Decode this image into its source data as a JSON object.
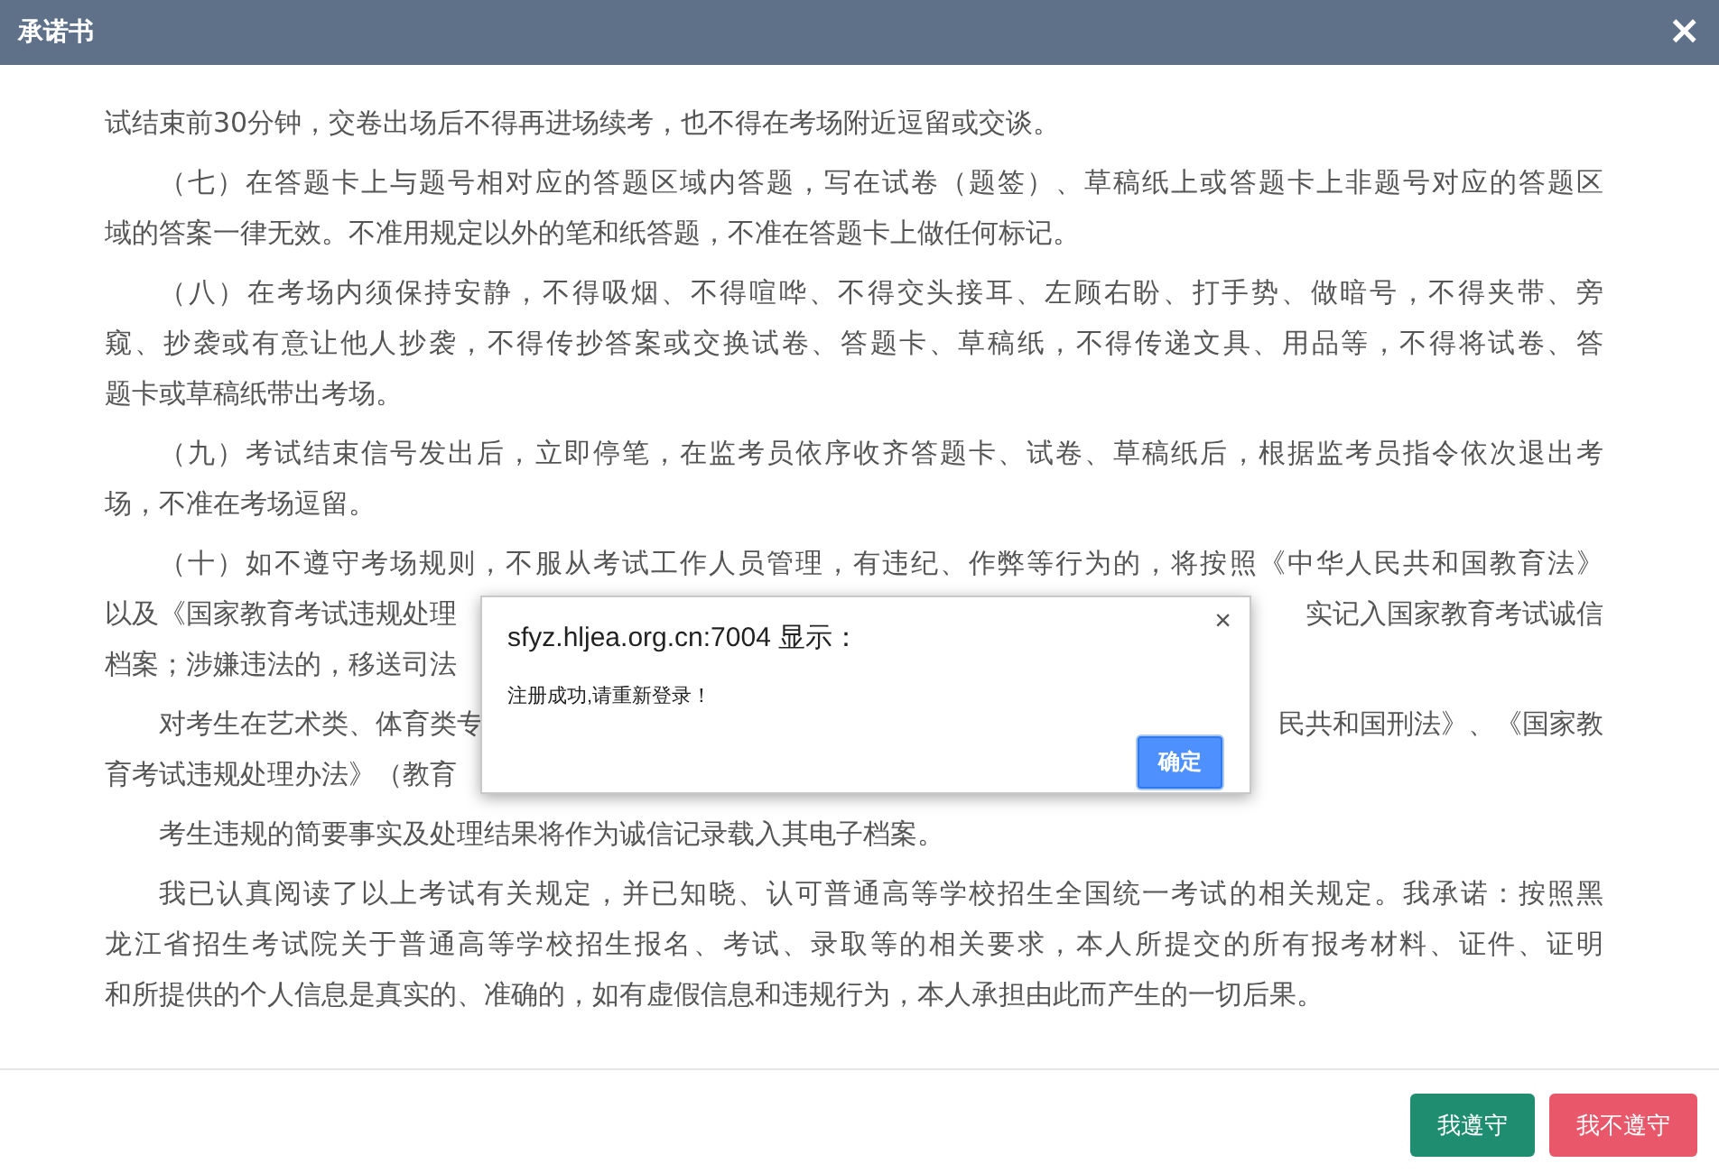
{
  "window": {
    "title": "承诺书",
    "close": "×"
  },
  "paragraphs": [
    {
      "indent": false,
      "lines": [
        "试结束前30分钟，交卷出场后不得再进场续考，也不得在考场附近逗留或交谈。"
      ]
    },
    {
      "indent": true,
      "lines": [
        "（七）在答题卡上与题号相对应的答题区域内答题，写在试卷（题签）、草稿纸上或答题卡上非题号对应的答题区",
        "域的答案一律无效。不准用规定以外的笔和纸答题，不准在答题卡上做任何标记。"
      ]
    },
    {
      "indent": true,
      "lines": [
        "（八）在考场内须保持安静，不得吸烟、不得喧哗、不得交头接耳、左顾右盼、打手势、做暗号，不得夹带、旁",
        "窥、抄袭或有意让他人抄袭，不得传抄答案或交换试卷、答题卡、草稿纸，不得传递文具、用品等，不得将试卷、答",
        "题卡或草稿纸带出考场。"
      ]
    },
    {
      "indent": true,
      "lines": [
        "（九）考试结束信号发出后，立即停笔，在监考员依序收齐答题卡、试卷、草稿纸后，根据监考员指令依次退出考",
        "场，不准在考场逗留。"
      ]
    },
    {
      "indent": true,
      "lines": [
        "（十）如不遵守考场规则，不服从考试工作人员管理，有违纪、作弊等行为的，将按照《中华人民共和国教育法》",
        {
          "left": "以及《国家教育考试违规处理",
          "right": "实记入国家教育考试诚信"
        },
        {
          "left": "档案；涉嫌违法的，移送司法"
        }
      ]
    },
    {
      "indent": true,
      "lines": [
        {
          "left": "对考生在艺术类、体育类专",
          "right": "民共和国刑法》、《国家教"
        },
        {
          "left": "育考试违规处理办法》（教育"
        }
      ]
    },
    {
      "indent": true,
      "lines": [
        "考生违规的简要事实及处理结果将作为诚信记录载入其电子档案。"
      ]
    },
    {
      "indent": true,
      "lines": [
        "我已认真阅读了以上考试有关规定，并已知晓、认可普通高等学校招生全国统一考试的相关规定。我承诺：按照黑",
        "龙江省招生考试院关于普通高等学校招生报名、考试、录取等的相关要求，本人所提交的所有报考材料、证件、证明",
        "和所提供的个人信息是真实的、准确的，如有虚假信息和违规行为，本人承担由此而产生的一切后果。"
      ]
    }
  ],
  "alert": {
    "title": "sfyz.hljea.org.cn:7004 显示：",
    "close": "×",
    "message": "注册成功,请重新登录！",
    "button": "确定"
  },
  "buttons": [
    {
      "label": "我遵守",
      "kind": "accept"
    },
    {
      "label": "我不遵守",
      "kind": "decline"
    }
  ]
}
